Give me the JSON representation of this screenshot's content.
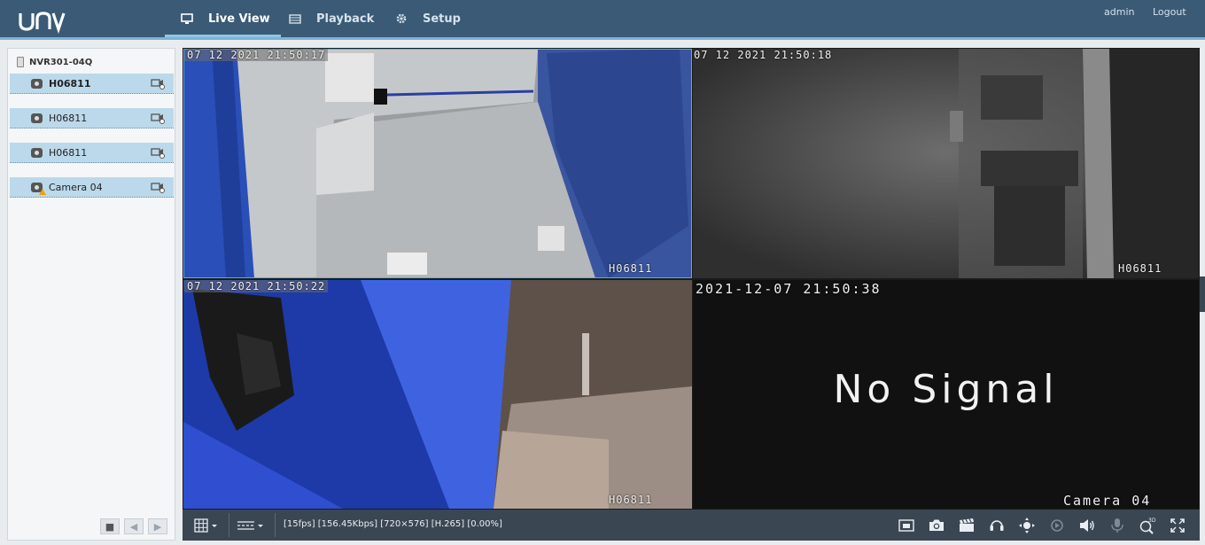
{
  "header": {
    "logo": "unv",
    "nav": [
      {
        "label": "Live View",
        "icon": "monitor-icon",
        "active": true
      },
      {
        "label": "Playback",
        "icon": "film-icon",
        "active": false
      },
      {
        "label": "Setup",
        "icon": "gear-icon",
        "active": false
      }
    ],
    "user": "admin",
    "logout": "Logout"
  },
  "sidebar": {
    "device": "NVR301-04Q",
    "cameras": [
      {
        "label": "H06811",
        "icon": "camera-icon",
        "status": "online",
        "bold": true
      },
      {
        "label": "H06811",
        "icon": "camera-icon",
        "status": "online",
        "bold": false
      },
      {
        "label": "H06811",
        "icon": "camera-icon",
        "status": "online",
        "bold": false
      },
      {
        "label": "Camera 04",
        "icon": "camera-warning-icon",
        "status": "warning",
        "bold": false
      }
    ]
  },
  "video": {
    "tiles": [
      {
        "timestamp": "07 12 2021  21:50:17",
        "name": "H06811",
        "selected": true
      },
      {
        "timestamp": "07 12 2021  21:50:18",
        "name": "H06811",
        "selected": false
      },
      {
        "timestamp": "07 12 2021  21:50:22",
        "name": "H06811",
        "selected": false
      },
      {
        "timestamp": "2021-12-07  21:50:38",
        "name": "Camera  04",
        "message": "No  Signal",
        "selected": false
      }
    ]
  },
  "toolbar": {
    "status": "[15fps] [156.45Kbps] [720×576] [H.265] [0.00%]",
    "buttons": [
      "screen-layout-icon",
      "stream-select-icon",
      "picture-in-picture-icon",
      "snapshot-icon",
      "record-icon",
      "two-way-audio-icon",
      "ptz-icon",
      "digital-zoom-icon",
      "volume-icon",
      "microphone-icon",
      "3d-positioning-icon",
      "fullscreen-icon"
    ]
  },
  "colors": {
    "header": "#3a5a75",
    "accent": "#7fb2d5",
    "selected_tile": "#46b5e3",
    "sidebar_row": "#bcd9eb",
    "toolbar": "#3b4653"
  }
}
